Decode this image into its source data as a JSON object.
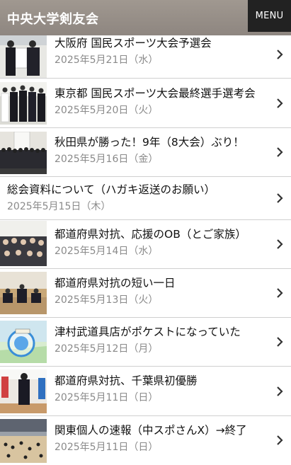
{
  "header": {
    "site_title": "中央大学剣友会",
    "menu_label": "MENU"
  },
  "posts": [
    {
      "title": "大阪府 国民スポーツ大会予選会",
      "date": "2025年5月21日（水）",
      "thumb": "two-kendoka-photo"
    },
    {
      "title": "東京都 国民スポーツ大会最終選手選考会",
      "date": "2025年5月20日（火）",
      "thumb": "team-photo"
    },
    {
      "title": "秋田県が勝った！9年（8大会）ぶり！",
      "date": "2025年5月16日（金）",
      "thumb": "group-photo"
    },
    {
      "title": "総会資料について（ハガキ返送のお願い）",
      "date": "2025年5月15日（木）",
      "thumb": ""
    },
    {
      "title": "都道府県対抗、応援のOB（とご家族）",
      "date": "2025年5月14日（水）",
      "thumb": "supporters-photo"
    },
    {
      "title": "都道府県対抗の短い一日",
      "date": "2025年5月13日（火）",
      "thumb": "seated-kendoka-photo"
    },
    {
      "title": "津村武道具店がポケストになっていた",
      "date": "2025年5月12日（月）",
      "thumb": "pokestop-screenshot"
    },
    {
      "title": "都道府県対抗、千葉県初優勝",
      "date": "2025年5月11日（日）",
      "thumb": "kendoka-standing-photo"
    },
    {
      "title": "関東個人の速報（中スポさんX）→終了",
      "date": "2025年5月11日（日）",
      "thumb": "arena-photo"
    }
  ]
}
